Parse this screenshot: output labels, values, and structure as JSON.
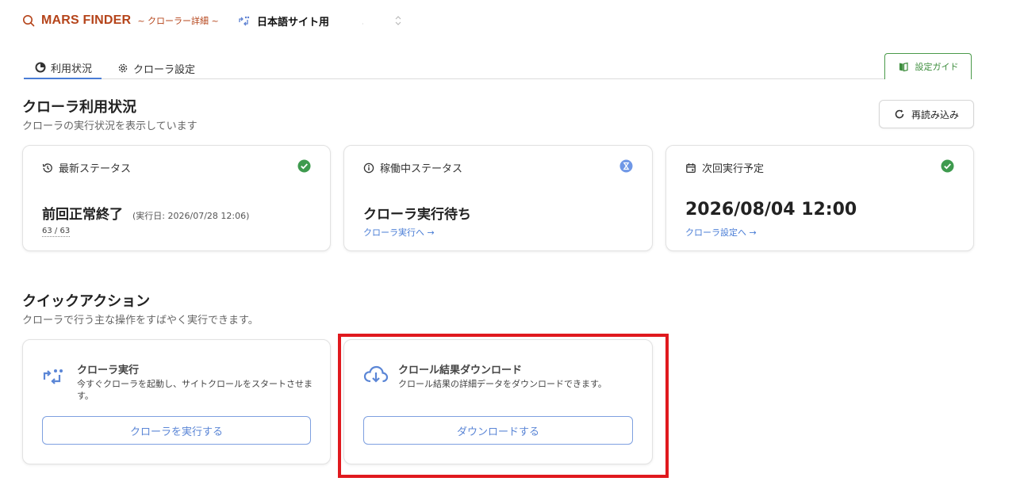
{
  "header": {
    "brand": "MARS FINDER",
    "subtitle": "~ クローラー詳細 ~",
    "site_name": "日本語サイト用",
    "site_dot": "·"
  },
  "tabs": [
    {
      "label": "利用状況",
      "active": true
    },
    {
      "label": "クローラ設定",
      "active": false
    }
  ],
  "guide": {
    "label": "設定ガイド"
  },
  "usage": {
    "title": "クローラ利用状況",
    "subtitle": "クローラの実行状況を表示しています",
    "reload_label": "再読み込み"
  },
  "status_cards": [
    {
      "heading": "最新ステータス",
      "value": "前回正常終了",
      "exec": "(実行日: 2026/07/28 12:06)",
      "count": "63 / 63",
      "badge": "check-circle-icon"
    },
    {
      "heading": "稼働中ステータス",
      "value": "クローラ実行待ち",
      "link": "クローラ実行へ →",
      "badge": "hourglass-icon"
    },
    {
      "heading": "次回実行予定",
      "value": "2026/08/04 12:00",
      "link": "クローラ設定へ →",
      "badge": "check-circle-icon"
    }
  ],
  "quick": {
    "title": "クイックアクション",
    "subtitle": "クローラで行う主な操作をすばやく実行できます。",
    "actions": [
      {
        "title": "クローラ実行",
        "desc": "今すぐクローラを起動し、サイトクロールをスタートさせます。",
        "button": "クローラを実行する"
      },
      {
        "title": "クロール結果ダウンロード",
        "desc": "クロール結果の詳細データをダウンロードできます。",
        "button": "ダウンロードする"
      }
    ]
  },
  "colors": {
    "brand": "#b5441a",
    "accent": "#4a7dd6",
    "success": "#3e9a4e",
    "highlight": "#e0191e"
  }
}
